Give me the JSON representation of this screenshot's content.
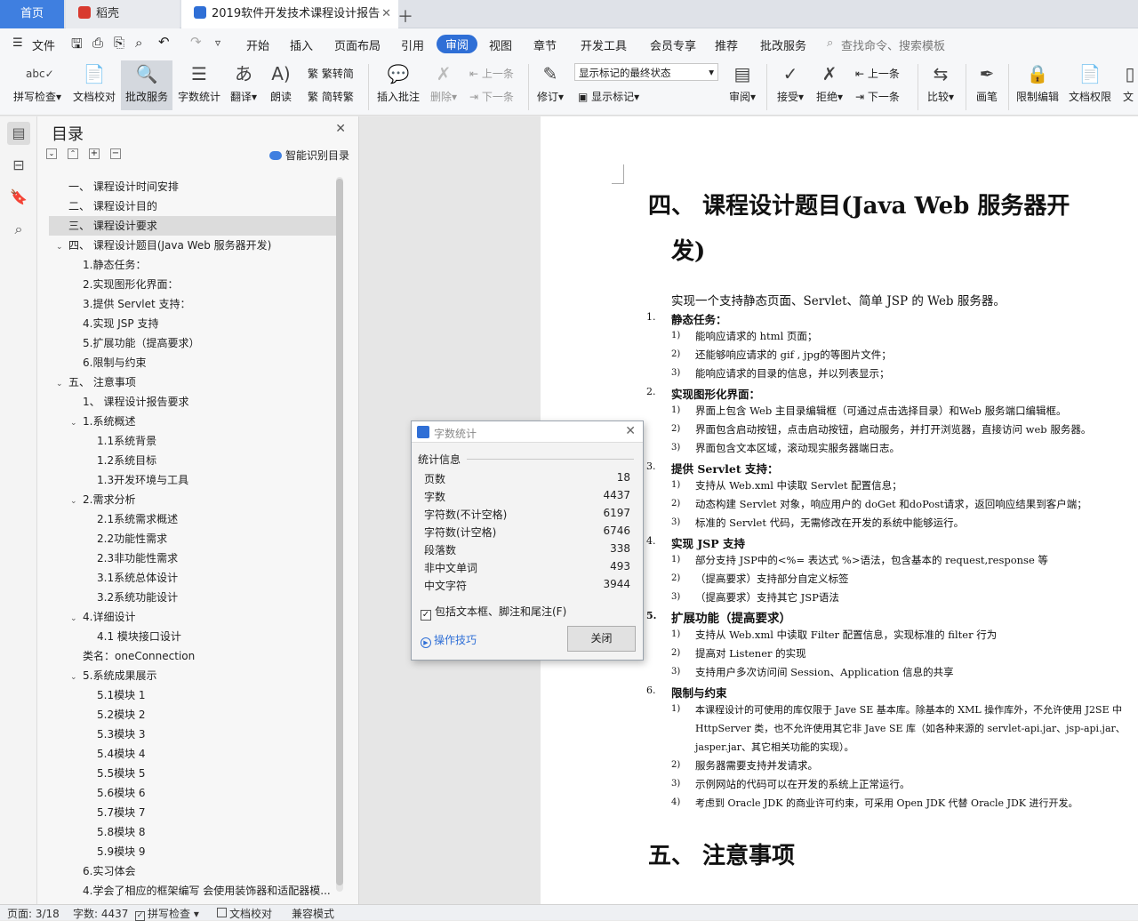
{
  "tabs": {
    "home": "首页",
    "daoke": "稻壳",
    "doc": "2019软件开发技术课程设计报告"
  },
  "menu": {
    "file": "文件",
    "items": [
      "开始",
      "插入",
      "页面布局",
      "引用",
      "审阅",
      "视图",
      "章节",
      "开发工具",
      "会员专享",
      "推荐",
      "批改服务"
    ],
    "search": "查找命令、搜索模板"
  },
  "ribbon": {
    "spell": "拼写检查",
    "proof": "文档校对",
    "review_service": "批改服务",
    "word_count": "字数统计",
    "translate": "翻译",
    "read": "朗读",
    "trad": "繁转简",
    "simp": "简转繁",
    "insert_comment": "插入批注",
    "delete": "删除",
    "prev": "上一条",
    "next": "下一条",
    "revise": "修订",
    "markup_state": "显示标记的最终状态",
    "show_markup": "显示标记",
    "review": "审阅",
    "accept": "接受",
    "reject": "拒绝",
    "prev2": "上一条",
    "next2": "下一条",
    "compare": "比较",
    "pen": "画笔",
    "restrict": "限制编辑",
    "perm": "文档权限",
    "doc": "文"
  },
  "toc": {
    "title": "目录",
    "smart": "智能识别目录",
    "items": [
      {
        "label": "一、 课程设计时间安排",
        "indent": 0,
        "caret": ""
      },
      {
        "label": "二、 课程设计目的",
        "indent": 0,
        "caret": ""
      },
      {
        "label": "三、 课程设计要求",
        "indent": 0,
        "caret": "",
        "selected": true
      },
      {
        "label": "四、 课程设计题目(Java Web 服务器开发)",
        "indent": 0,
        "caret": "v"
      },
      {
        "label": "1.静态任务：",
        "indent": 1,
        "caret": ""
      },
      {
        "label": "2.实现图形化界面：",
        "indent": 1,
        "caret": ""
      },
      {
        "label": "3.提供 Servlet 支持：",
        "indent": 1,
        "caret": ""
      },
      {
        "label": "4.实现 JSP 支持",
        "indent": 1,
        "caret": ""
      },
      {
        "label": "5.扩展功能（提高要求）",
        "indent": 1,
        "caret": ""
      },
      {
        "label": "6.限制与约束",
        "indent": 1,
        "caret": ""
      },
      {
        "label": "五、 注意事项",
        "indent": 0,
        "caret": "v"
      },
      {
        "label": "1、 课程设计报告要求",
        "indent": 1,
        "caret": ""
      },
      {
        "label": "1.系统概述",
        "indent": 1,
        "caret": "v"
      },
      {
        "label": "1.1系统背景",
        "indent": 2,
        "caret": ""
      },
      {
        "label": "1.2系统目标",
        "indent": 2,
        "caret": ""
      },
      {
        "label": "1.3开发环境与工具",
        "indent": 2,
        "caret": ""
      },
      {
        "label": "2.需求分析",
        "indent": 1,
        "caret": "v"
      },
      {
        "label": "2.1系统需求概述",
        "indent": 2,
        "caret": ""
      },
      {
        "label": "2.2功能性需求",
        "indent": 2,
        "caret": ""
      },
      {
        "label": "2.3非功能性需求",
        "indent": 2,
        "caret": ""
      },
      {
        "label": "3.1系统总体设计",
        "indent": 2,
        "caret": ""
      },
      {
        "label": "3.2系统功能设计",
        "indent": 2,
        "caret": ""
      },
      {
        "label": "4.详细设计",
        "indent": 1,
        "caret": "v"
      },
      {
        "label": "4.1 模块接口设计",
        "indent": 2,
        "caret": ""
      },
      {
        "label": "类名：oneConnection",
        "indent": 1,
        "caret": ""
      },
      {
        "label": "5.系统成果展示",
        "indent": 1,
        "caret": "v"
      },
      {
        "label": "5.1模块 1",
        "indent": 2,
        "caret": ""
      },
      {
        "label": "5.2模块 2",
        "indent": 2,
        "caret": ""
      },
      {
        "label": "5.3模块 3",
        "indent": 2,
        "caret": ""
      },
      {
        "label": "5.4模块 4",
        "indent": 2,
        "caret": ""
      },
      {
        "label": "5.5模块 5",
        "indent": 2,
        "caret": ""
      },
      {
        "label": "5.6模块 6",
        "indent": 2,
        "caret": ""
      },
      {
        "label": "5.7模块 7",
        "indent": 2,
        "caret": ""
      },
      {
        "label": "5.8模块 8",
        "indent": 2,
        "caret": ""
      },
      {
        "label": "5.9模块 9",
        "indent": 2,
        "caret": ""
      },
      {
        "label": "6.实习体会",
        "indent": 1,
        "caret": ""
      },
      {
        "label": "4.学会了相应的框架编写 会使用装饰器和适配器模...",
        "indent": 1,
        "caret": ""
      }
    ]
  },
  "doc": {
    "h4": "四、 课程设计题目(Java Web 服务器开",
    "h4b": "发)",
    "intro": "实现一个支持静态页面、Servlet、简单 JSP 的 Web 服务器。",
    "s1": "静态任务：",
    "s1a": "能响应请求的 html 页面；",
    "s1b": "还能够响应请求的 gif , jpg的等图片文件；",
    "s1c": "能响应请求的目录的信息，并以列表显示；",
    "s2": "实现图形化界面：",
    "s2a": "界面上包含 Web 主目录编辑框（可通过点击选择目录）和Web 服务端口编辑框。",
    "s2b": "界面包含启动按钮，点击启动按钮，启动服务，并打开浏览器，直接访问 web 服务器。",
    "s2c": "界面包含文本区域，滚动现实服务器端日志。",
    "s3": "提供 Servlet 支持：",
    "s3a": "支持从 Web.xml 中读取 Servlet 配置信息；",
    "s3b": "动态构建 Servlet 对象，响应用户的 doGet 和doPost请求，返回响应结果到客户端；",
    "s3c": "标准的 Servlet 代码，无需修改在开发的系统中能够运行。",
    "s4": "实现 JSP 支持",
    "s4a": "部分支持 JSP中的<%= 表达式 %>语法，包含基本的 request,response 等",
    "s4b": "（提高要求）支持部分自定义标签",
    "s4c": "（提高要求）支持其它 JSP语法",
    "s5": "扩展功能（提高要求）",
    "s5a": "支持从 Web.xml 中读取 Filter 配置信息，实现标准的 filter 行为",
    "s5b": "提高对 Listener 的实现",
    "s5c": "支持用户多次访问间 Session、Application 信息的共享",
    "s6": "限制与约束",
    "s6a": "本课程设计的可使用的库仅限于 Jave SE 基本库。除基本的 XML 操作库外，不允许使用 J2SE 中",
    "s6a2": "HttpServer 类，也不允许使用其它非 Jave SE 库（如各种来源的 servlet-api.jar、jsp-api.jar、",
    "s6a3": "jasper.jar、其它相关功能的实现）。",
    "s6b": "服务器需要支持并发请求。",
    "s6c": "示例网站的代码可以在开发的系统上正常运行。",
    "s6d": "考虑到 Oracle JDK 的商业许可约束，可采用 Open JDK 代替 Oracle JDK 进行开发。",
    "h5": "五、 注意事项"
  },
  "dialog": {
    "title": "字数统计",
    "section": "统计信息",
    "rows": [
      {
        "k": "页数",
        "v": "18"
      },
      {
        "k": "字数",
        "v": "4437"
      },
      {
        "k": "字符数(不计空格)",
        "v": "6197"
      },
      {
        "k": "字符数(计空格)",
        "v": "6746"
      },
      {
        "k": "段落数",
        "v": "338"
      },
      {
        "k": "非中文单词",
        "v": "493"
      },
      {
        "k": "中文字符",
        "v": "3944"
      }
    ],
    "checkbox": "包括文本框、脚注和尾注(F)",
    "tips": "操作技巧",
    "close": "关闭"
  },
  "status": {
    "page": "页面: 3/18",
    "words": "字数: 4437",
    "spell": "拼写检查",
    "proof": "文档校对",
    "compat": "兼容模式"
  },
  "colors": {
    "accent": "#3f7fe0",
    "tab_active": "#2f6fd6"
  }
}
